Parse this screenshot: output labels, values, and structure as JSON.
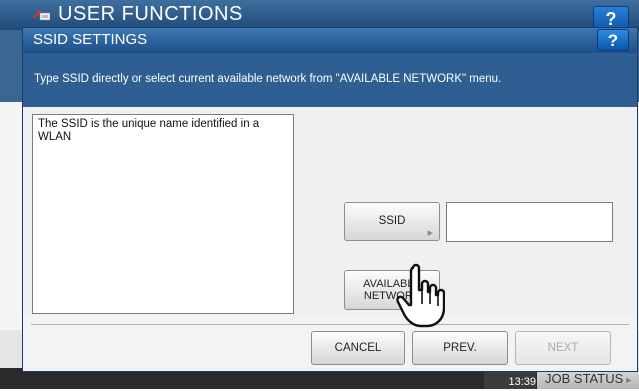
{
  "background": {
    "title": "USER FUNCTIONS",
    "help_label": "?"
  },
  "dialog": {
    "title": "SSID SETTINGS",
    "help_label": "?",
    "instruction": "Type SSID directly or select current available network from \"AVAILABLE NETWORK\" menu.",
    "description": "The SSID is the unique name identified in a WLAN",
    "ssid_button_label": "SSID",
    "ssid_value": "",
    "available_button_label_line1": "AVAILABLE",
    "available_button_label_line2": "NETWORK",
    "cancel_label": "CANCEL",
    "prev_label": "PREV.",
    "next_label": "NEXT"
  },
  "footer": {
    "time": "13:39",
    "job_status_label": "JOB STATUS"
  },
  "colors": {
    "header_blue": "#1c4f88",
    "instruction_bar": "#2f5f92",
    "help_blue": "#0b55a9"
  },
  "icons": [
    "user-functions-logo-icon",
    "help-icon",
    "arrow-right-icon",
    "pointer-hand-icon",
    "chevron-right-icon"
  ]
}
